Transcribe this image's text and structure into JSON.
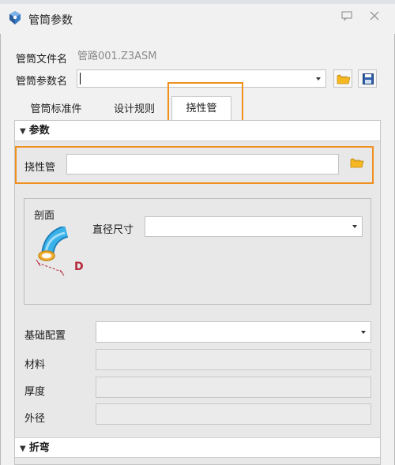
{
  "window": {
    "title": "管筒参数",
    "pin_icon": "pin-icon",
    "close_icon": "close-icon"
  },
  "header": {
    "file_name_label": "管筒文件名",
    "file_name_value": "管路001.Z3ASM",
    "param_name_label": "管筒参数名",
    "param_name_value": ""
  },
  "tabs": [
    {
      "label": "管筒标准件",
      "active": false
    },
    {
      "label": "设计规则",
      "active": false
    },
    {
      "label": "挠性管",
      "active": true
    }
  ],
  "params_section": {
    "title": "参数",
    "flex_tube_label": "挠性管",
    "flex_tube_value": "",
    "profile_group": {
      "label": "剖面",
      "diameter_label": "直径尺寸",
      "diameter_value": "",
      "diagram_marker": "D"
    },
    "base_config_label": "基础配置",
    "base_config_value": "",
    "material_label": "材料",
    "thickness_label": "厚度",
    "outer_diameter_label": "外径"
  },
  "bend_section": {
    "title": "折弯"
  },
  "colors": {
    "highlight": "#f0901e",
    "folder": "#f5b821",
    "tube": "#2aa3dc"
  }
}
